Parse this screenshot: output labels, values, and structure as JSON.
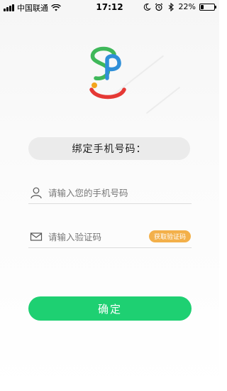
{
  "status_bar": {
    "carrier": "中国联通",
    "time": "17:12",
    "battery_percent": "22%",
    "battery_level": 0.22,
    "icons": [
      "signal-icon",
      "wifi-icon",
      "moon-icon",
      "alarm-icon",
      "bluetooth-icon",
      "battery-icon"
    ]
  },
  "logo": {
    "letters": "SP",
    "colors": {
      "s": "#3fb85a",
      "p": "#2f8fd8",
      "dot": "#f3a51d",
      "smile": "#e53935"
    }
  },
  "form": {
    "title": "绑定手机号码：",
    "phone_placeholder": "请输入您的手机号码",
    "code_placeholder": "请输入验证码",
    "get_code_label": "获取验证码",
    "confirm_label": "确定"
  },
  "colors": {
    "primary": "#1ed072",
    "code_button": "#f3b04a",
    "title_pill": "#ebebeb"
  }
}
